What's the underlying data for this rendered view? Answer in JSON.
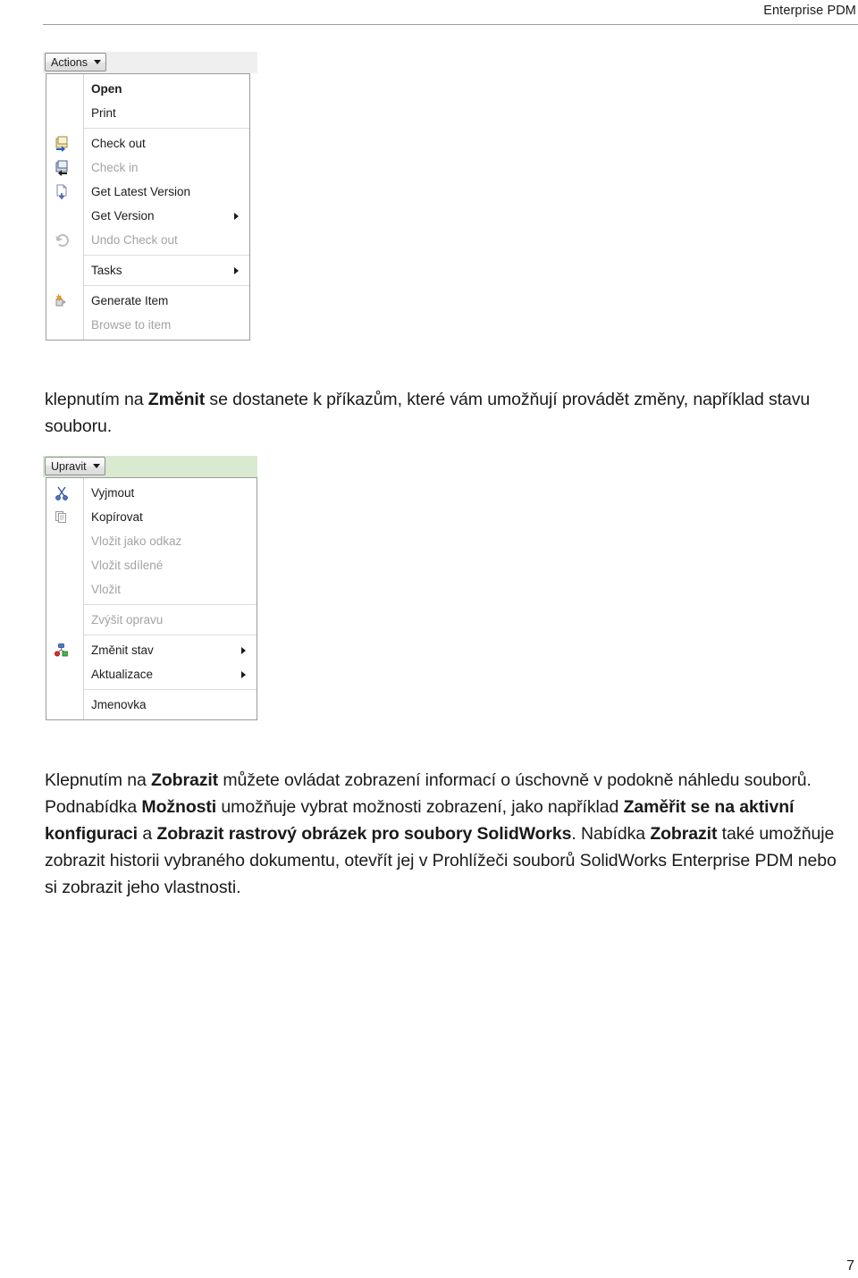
{
  "header": {
    "running_title": "Enterprise PDM"
  },
  "footer": {
    "page_number": "7"
  },
  "actions_menu": {
    "button_label": "Actions",
    "items": [
      {
        "label": "Open",
        "icon": "",
        "bold": true,
        "disabled": false,
        "submenu": false
      },
      {
        "label": "Print",
        "icon": "",
        "bold": false,
        "disabled": false,
        "submenu": false
      },
      {
        "label": "Check out",
        "icon": "check-out-icon",
        "bold": false,
        "disabled": false,
        "submenu": false
      },
      {
        "label": "Check in",
        "icon": "check-in-icon",
        "bold": false,
        "disabled": true,
        "submenu": false
      },
      {
        "label": "Get Latest Version",
        "icon": "get-latest-icon",
        "bold": false,
        "disabled": false,
        "submenu": false
      },
      {
        "label": "Get Version",
        "icon": "",
        "bold": false,
        "disabled": false,
        "submenu": true
      },
      {
        "label": "Undo Check out",
        "icon": "undo-icon",
        "bold": false,
        "disabled": true,
        "submenu": false
      },
      {
        "label": "Tasks",
        "icon": "",
        "bold": false,
        "disabled": false,
        "submenu": true
      },
      {
        "label": "Generate Item",
        "icon": "generate-item-icon",
        "bold": false,
        "disabled": false,
        "submenu": false
      },
      {
        "label": "Browse to item",
        "icon": "",
        "bold": false,
        "disabled": true,
        "submenu": false
      }
    ]
  },
  "upravit_menu": {
    "button_label": "Upravit",
    "items": [
      {
        "label": "Vyjmout",
        "icon": "cut-icon",
        "bold": false,
        "disabled": false,
        "submenu": false
      },
      {
        "label": "Kopírovat",
        "icon": "copy-icon",
        "bold": false,
        "disabled": false,
        "submenu": false
      },
      {
        "label": "Vložit jako odkaz",
        "icon": "",
        "bold": false,
        "disabled": true,
        "submenu": false
      },
      {
        "label": "Vložit sdílené",
        "icon": "",
        "bold": false,
        "disabled": true,
        "submenu": false
      },
      {
        "label": "Vložit",
        "icon": "",
        "bold": false,
        "disabled": true,
        "submenu": false
      },
      {
        "label": "Zvýšit opravu",
        "icon": "",
        "bold": false,
        "disabled": true,
        "submenu": false
      },
      {
        "label": "Změnit stav",
        "icon": "change-state-icon",
        "bold": false,
        "disabled": false,
        "submenu": true
      },
      {
        "label": "Aktualizace",
        "icon": "",
        "bold": false,
        "disabled": false,
        "submenu": true
      },
      {
        "label": "Jmenovka",
        "icon": "",
        "bold": false,
        "disabled": false,
        "submenu": false
      }
    ]
  },
  "paragraph_1": {
    "segments": [
      {
        "text": "klepnutím na ",
        "bold": false
      },
      {
        "text": "Změnit",
        "bold": true
      },
      {
        "text": " se dostanete k příkazům, které vám umožňují provádět změny, například stavu souboru.",
        "bold": false
      }
    ]
  },
  "paragraph_2": {
    "segments": [
      {
        "text": "Klepnutím na ",
        "bold": false
      },
      {
        "text": "Zobrazit",
        "bold": true
      },
      {
        "text": " můžete ovládat zobrazení informací o úschovně v podokně náhledu souborů. Podnabídka ",
        "bold": false
      },
      {
        "text": "Možnosti",
        "bold": true
      },
      {
        "text": " umožňuje vybrat možnosti zobrazení, jako například ",
        "bold": false
      },
      {
        "text": "Zaměřit se na aktivní konfiguraci",
        "bold": true
      },
      {
        "text": " a ",
        "bold": false
      },
      {
        "text": "Zobrazit rastrový obrázek pro soubory SolidWorks",
        "bold": true
      },
      {
        "text": ". Nabídka ",
        "bold": false
      },
      {
        "text": "Zobrazit",
        "bold": true
      },
      {
        "text": " také umožňuje zobrazit historii vybraného dokumentu, otevřít jej v Prohlížeči souborů SolidWorks Enterprise PDM nebo si zobrazit jeho vlastnosti.",
        "bold": false
      }
    ]
  },
  "colors": {
    "actions_band": "#efefef",
    "upravit_band": "#d9ead0",
    "menu_border": "#9a9a9a",
    "separator": "#dcdcdc",
    "disabled_text": "#a3a3a3"
  }
}
